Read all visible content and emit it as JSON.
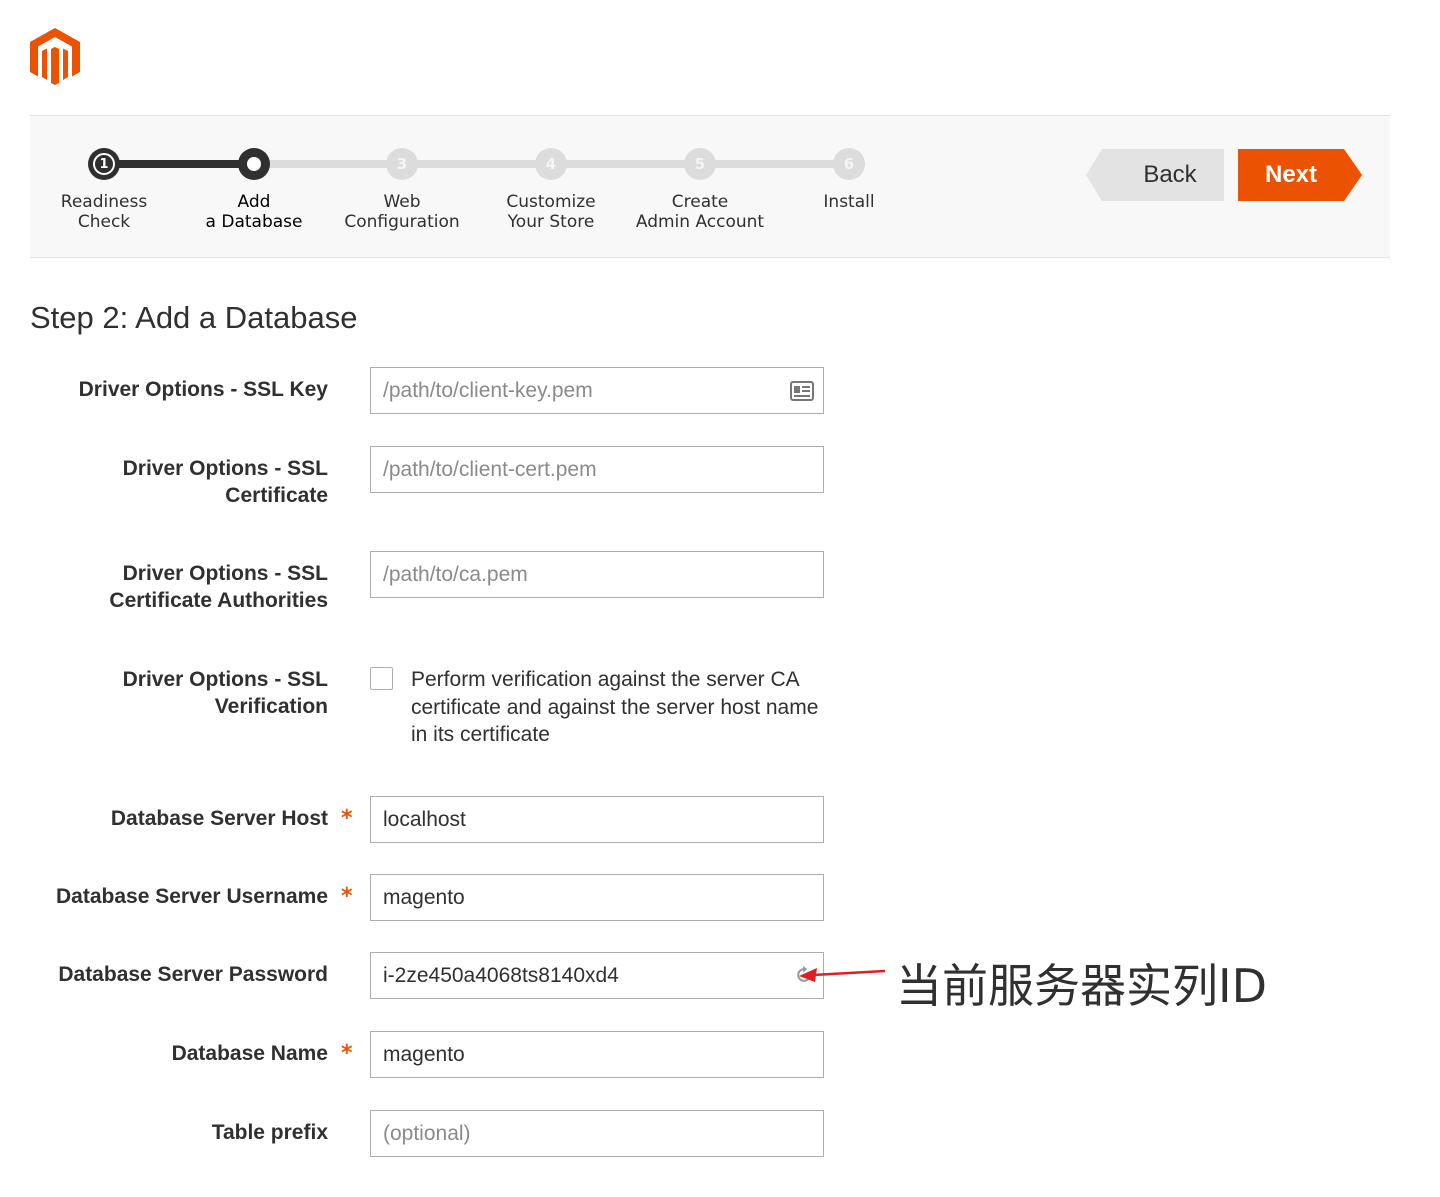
{
  "brand": {
    "logo_icon": "magento-logo-icon",
    "accent_color": "#eb5202"
  },
  "wizard": {
    "steps": [
      {
        "number": "1",
        "label_line1": "Readiness",
        "label_line2": "Check",
        "status": "done"
      },
      {
        "number": "2",
        "label_line1": "Add",
        "label_line2": "a Database",
        "status": "current"
      },
      {
        "number": "3",
        "label_line1": "Web",
        "label_line2": "Configuration",
        "status": "pending"
      },
      {
        "number": "4",
        "label_line1": "Customize",
        "label_line2": "Your Store",
        "status": "pending"
      },
      {
        "number": "5",
        "label_line1": "Create",
        "label_line2": "Admin Account",
        "status": "pending"
      },
      {
        "number": "6",
        "label_line1": "Install",
        "label_line2": "",
        "status": "pending"
      }
    ],
    "back_label": "Back",
    "next_label": "Next"
  },
  "page": {
    "title": "Step 2: Add a Database"
  },
  "form": {
    "ssl_key": {
      "label": "Driver Options - SSL Key",
      "placeholder": "/path/to/client-key.pem",
      "value": ""
    },
    "ssl_cert": {
      "label_line1": "Driver Options - SSL",
      "label_line2": "Certificate",
      "placeholder": "/path/to/client-cert.pem",
      "value": ""
    },
    "ssl_ca": {
      "label_line1": "Driver Options - SSL",
      "label_line2": "Certificate Authorities",
      "placeholder": "/path/to/ca.pem",
      "value": ""
    },
    "ssl_verify": {
      "label_line1": "Driver Options - SSL",
      "label_line2": "Verification",
      "checkbox_text": "Perform verification against the server CA certificate and against the server host name in its certificate",
      "checked": false
    },
    "db_host": {
      "label": "Database Server Host",
      "required_mark": "*",
      "value": "localhost"
    },
    "db_user": {
      "label": "Database Server Username",
      "required_mark": "*",
      "value": "magento"
    },
    "db_password": {
      "label": "Database Server Password",
      "value": "i-2ze450a4068ts8140xd4"
    },
    "db_name": {
      "label": "Database Name",
      "required_mark": "*",
      "value": "magento"
    },
    "table_prefix": {
      "label": "Table prefix",
      "placeholder": "(optional)",
      "value": ""
    }
  },
  "annotation": {
    "text": "当前服务器实列ID",
    "arrow_color": "#e02020"
  }
}
